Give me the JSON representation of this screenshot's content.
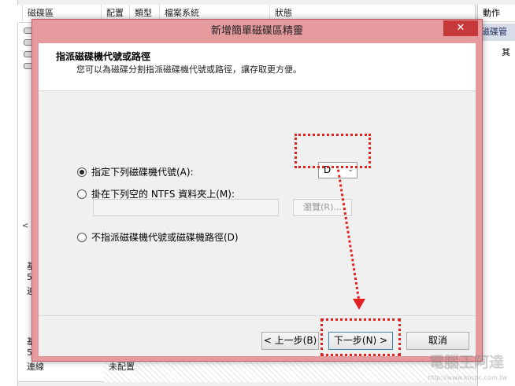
{
  "background": {
    "columns": [
      "磁碟區",
      "配置",
      "類型",
      "檔案系統",
      "狀態"
    ],
    "actions_header": "動作",
    "actions_selected": "磁碟管",
    "actions_item": "其",
    "scroll_left": "<",
    "lower_labels": [
      "基",
      "5",
      "連",
      "基",
      "5",
      "連線"
    ],
    "bottom_label": "未配置"
  },
  "dialog": {
    "title": "新增簡單磁碟區精靈",
    "close_glyph": "✕",
    "header_title": "指派磁碟機代號或路徑",
    "header_desc": "您可以為磁碟分割指派磁碟機代號或路徑，讓存取更方便。",
    "options": {
      "assign_letter": "指定下列磁碟機代號(A):",
      "mount_folder": "掛在下列空的 NTFS 資料夾上(M):",
      "no_assign": "不指派磁碟機代號或磁碟機路徑(D)"
    },
    "selected_option": "assign_letter",
    "drive_letter": "D",
    "drive_arrow": "⌄",
    "folder_path": "",
    "browse_label": "瀏覽(R)...",
    "back_label": "< 上一步(B)",
    "next_label": "下一步(N) >",
    "cancel_label": "取消"
  },
  "watermark": {
    "main": "電腦王阿達",
    "sub": "http://www.kocpc.com.tw"
  },
  "colors": {
    "highlight": "#e41f1f",
    "title_bar": "#e59a9e",
    "close_button": "#c7383a"
  }
}
